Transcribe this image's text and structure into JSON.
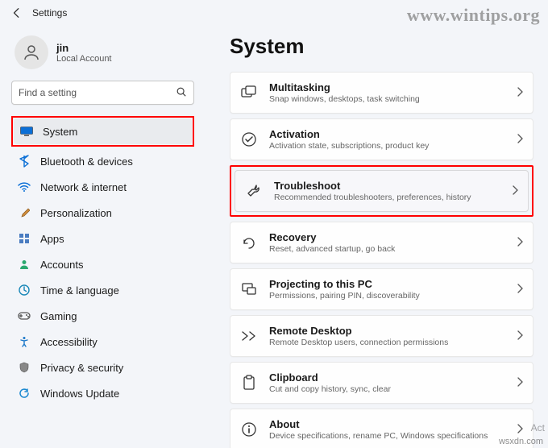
{
  "header": {
    "title": "Settings"
  },
  "profile": {
    "name": "jin",
    "subtitle": "Local Account"
  },
  "search": {
    "placeholder": "Find a setting"
  },
  "sidebar": {
    "items": [
      {
        "label": "System"
      },
      {
        "label": "Bluetooth & devices"
      },
      {
        "label": "Network & internet"
      },
      {
        "label": "Personalization"
      },
      {
        "label": "Apps"
      },
      {
        "label": "Accounts"
      },
      {
        "label": "Time & language"
      },
      {
        "label": "Gaming"
      },
      {
        "label": "Accessibility"
      },
      {
        "label": "Privacy & security"
      },
      {
        "label": "Windows Update"
      }
    ]
  },
  "main": {
    "heading": "System",
    "cards": [
      {
        "title": "Multitasking",
        "subtitle": "Snap windows, desktops, task switching"
      },
      {
        "title": "Activation",
        "subtitle": "Activation state, subscriptions, product key"
      },
      {
        "title": "Troubleshoot",
        "subtitle": "Recommended troubleshooters, preferences, history"
      },
      {
        "title": "Recovery",
        "subtitle": "Reset, advanced startup, go back"
      },
      {
        "title": "Projecting to this PC",
        "subtitle": "Permissions, pairing PIN, discoverability"
      },
      {
        "title": "Remote Desktop",
        "subtitle": "Remote Desktop users, connection permissions"
      },
      {
        "title": "Clipboard",
        "subtitle": "Cut and copy history, sync, clear"
      },
      {
        "title": "About",
        "subtitle": "Device specifications, rename PC, Windows specifications"
      }
    ]
  },
  "watermark": "www.wintips.org",
  "credit": "wsxdn.com",
  "ghost": "Act"
}
